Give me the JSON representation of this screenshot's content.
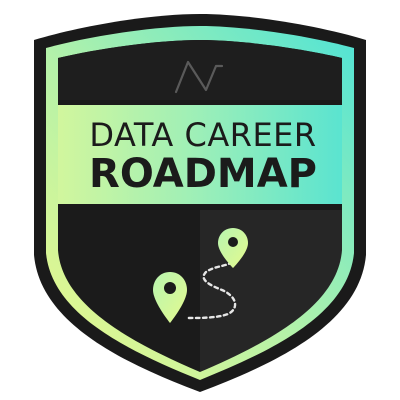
{
  "badge": {
    "title_line_1": "DATA CAREER",
    "title_line_2": "ROADMAP",
    "logo_icon": "brand-logo-icon",
    "pin_icons": [
      "map-pin-icon",
      "map-pin-icon"
    ],
    "route_icon": "dotted-route-icon"
  },
  "colors": {
    "outline": "#1a1a1a",
    "gradient_top_right": "#5de6d8",
    "gradient_mid": "#a9f0b4",
    "gradient_bottom_left": "#e6f78a",
    "dark_panel": "#1c1c1c",
    "dark_panel_right": "#2a2a2a",
    "pin_fill": "#c6f59e",
    "route_dots": "#e8e8e8"
  }
}
